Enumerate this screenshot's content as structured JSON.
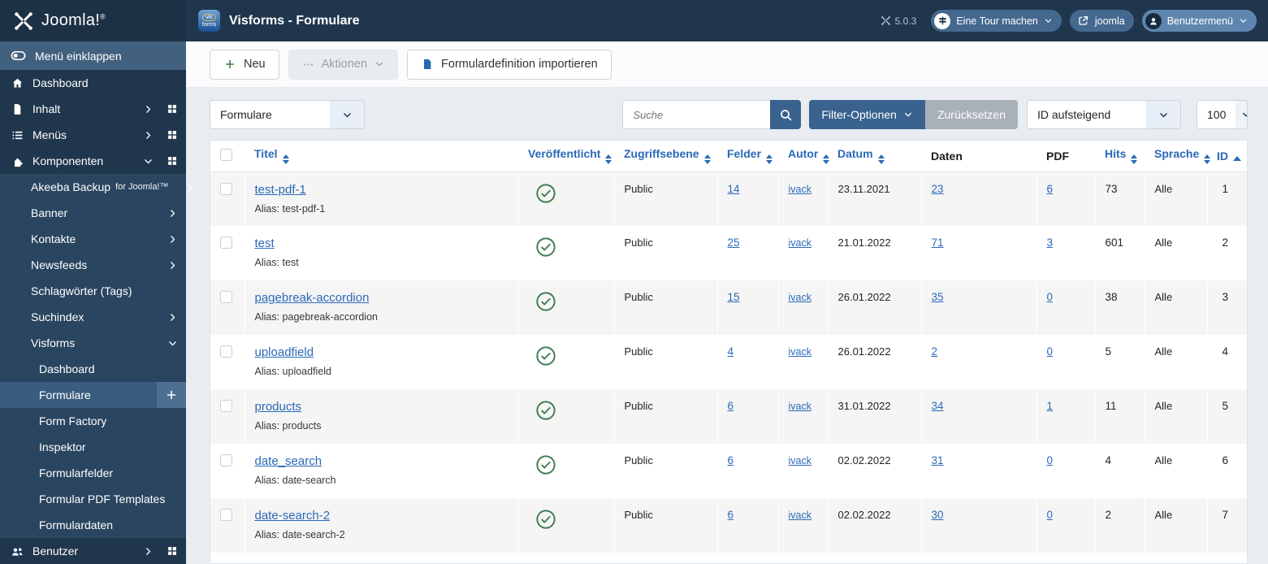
{
  "colors": {
    "topbar_bg": "#20364d",
    "sidebar_submenu_bg": "#294560",
    "sidebar_active_bg": "#3a5d7f",
    "accent_button_blue": "#39628e",
    "link_blue": "#2a69b6",
    "success_green": "#3f7d4f",
    "row_stripe": "#f5f5f5"
  },
  "brand": {
    "name": "Joomla!",
    "reg": "®"
  },
  "header": {
    "app_icon_line1": "vis",
    "app_icon_line2": "forms",
    "title": "Visforms - Formulare",
    "version": "5.0.3",
    "tour_button": "Eine Tour machen",
    "site_button": "joomla",
    "user_button": "Benutzermenü"
  },
  "sidebar": {
    "toggle_label": "Menü einklappen",
    "items": [
      {
        "label": "Dashboard",
        "icon": "home",
        "level": 1
      },
      {
        "label": "Inhalt",
        "icon": "file",
        "level": 1,
        "chevron": "right",
        "grid": true
      },
      {
        "label": "Menüs",
        "icon": "list",
        "level": 1,
        "chevron": "right",
        "grid": true
      },
      {
        "label": "Komponenten",
        "icon": "puzzle",
        "level": 1,
        "chevron": "down",
        "grid": true
      },
      {
        "label": "Akeeba Backup",
        "suffix": "for Joomla!™",
        "level": 2,
        "chevron": "right"
      },
      {
        "label": "Banner",
        "level": 2,
        "chevron": "right"
      },
      {
        "label": "Kontakte",
        "level": 2,
        "chevron": "right"
      },
      {
        "label": "Newsfeeds",
        "level": 2,
        "chevron": "right"
      },
      {
        "label": "Schlagwörter (Tags)",
        "level": 2
      },
      {
        "label": "Suchindex",
        "level": 2,
        "chevron": "right"
      },
      {
        "label": "Visforms",
        "level": 2,
        "chevron": "down"
      },
      {
        "label": "Dashboard",
        "level": 3
      },
      {
        "label": "Formulare",
        "level": 3,
        "active": true,
        "plus": true
      },
      {
        "label": "Form Factory",
        "level": 3
      },
      {
        "label": "Inspektor",
        "level": 3
      },
      {
        "label": "Formularfelder",
        "level": 3
      },
      {
        "label": "Formular PDF Templates",
        "level": 3
      },
      {
        "label": "Formulardaten",
        "level": 3
      },
      {
        "label": "Benutzer",
        "icon": "users",
        "level": 1,
        "chevron": "right",
        "grid": true
      }
    ]
  },
  "toolbar": {
    "new_label": "Neu",
    "actions_label": "Aktionen",
    "import_label": "Formulardefinition importieren"
  },
  "filters": {
    "view_select": "Formulare",
    "search_placeholder": "Suche",
    "filter_options_label": "Filter-Optionen",
    "reset_label": "Zurücksetzen",
    "sort_select": "ID aufsteigend",
    "limit_select": "100"
  },
  "table": {
    "headers": [
      {
        "label": "Titel",
        "sortable": true
      },
      {
        "label": "Veröffentlicht",
        "sortable": true
      },
      {
        "label": "Zugriffsebene",
        "sortable": true
      },
      {
        "label": "Felder",
        "sortable": true
      },
      {
        "label": "Autor",
        "sortable": true
      },
      {
        "label": "Datum",
        "sortable": true
      },
      {
        "label": "Daten",
        "sortable": false
      },
      {
        "label": "PDF",
        "sortable": false
      },
      {
        "label": "Hits",
        "sortable": true
      },
      {
        "label": "Sprache",
        "sortable": true
      },
      {
        "label": "ID",
        "sortable": true,
        "sorted": "asc"
      }
    ],
    "rows": [
      {
        "title": "test-pdf-1",
        "alias": "Alias: test-pdf-1",
        "published": true,
        "access": "Public",
        "fields": "14",
        "author": "ivack",
        "date": "23.11.2021",
        "data": "23",
        "pdf": "6",
        "hits": "73",
        "language": "Alle",
        "id": "1"
      },
      {
        "title": "test",
        "alias": "Alias: test",
        "published": true,
        "access": "Public",
        "fields": "25",
        "author": "ivack",
        "date": "21.01.2022",
        "data": "71",
        "pdf": "3",
        "hits": "601",
        "language": "Alle",
        "id": "2"
      },
      {
        "title": "pagebreak-accordion",
        "alias": "Alias: pagebreak-accordion",
        "published": true,
        "access": "Public",
        "fields": "15",
        "author": "ivack",
        "date": "26.01.2022",
        "data": "35",
        "pdf": "0",
        "hits": "38",
        "language": "Alle",
        "id": "3"
      },
      {
        "title": "uploadfield",
        "alias": "Alias: uploadfield",
        "published": true,
        "access": "Public",
        "fields": "4",
        "author": "ivack",
        "date": "26.01.2022",
        "data": "2",
        "pdf": "0",
        "hits": "5",
        "language": "Alle",
        "id": "4"
      },
      {
        "title": "products",
        "alias": "Alias: products",
        "published": true,
        "access": "Public",
        "fields": "6",
        "author": "ivack",
        "date": "31.01.2022",
        "data": "34",
        "pdf": "1",
        "hits": "11",
        "language": "Alle",
        "id": "5"
      },
      {
        "title": "date_search",
        "alias": "Alias: date-search",
        "published": true,
        "access": "Public",
        "fields": "6",
        "author": "ivack",
        "date": "02.02.2022",
        "data": "31",
        "pdf": "0",
        "hits": "4",
        "language": "Alle",
        "id": "6"
      },
      {
        "title": "date-search-2",
        "alias": "Alias: date-search-2",
        "published": true,
        "access": "Public",
        "fields": "6",
        "author": "ivack",
        "date": "02.02.2022",
        "data": "30",
        "pdf": "0",
        "hits": "2",
        "language": "Alle",
        "id": "7"
      }
    ]
  }
}
